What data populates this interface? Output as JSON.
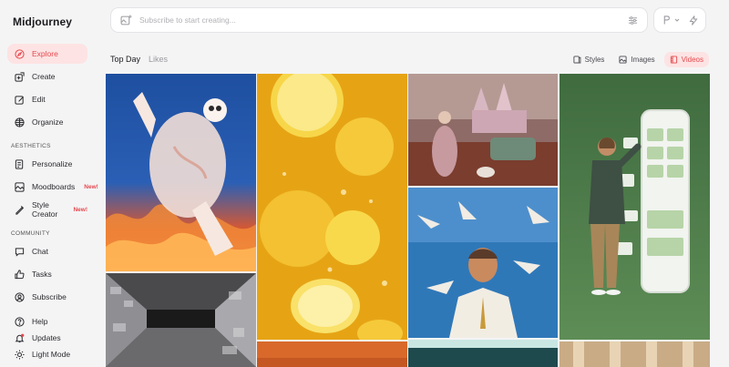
{
  "app": {
    "brand": "Midjourney"
  },
  "sidebar": {
    "main_items": [
      {
        "label": "Explore",
        "icon": "compass-icon",
        "active": true
      },
      {
        "label": "Create",
        "icon": "create-icon"
      },
      {
        "label": "Edit",
        "icon": "edit-icon"
      },
      {
        "label": "Organize",
        "icon": "grid-icon"
      }
    ],
    "aesthetics_label": "AESTHETICS",
    "aesthetics_items": [
      {
        "label": "Personalize",
        "icon": "personalize-icon"
      },
      {
        "label": "Moodboards",
        "icon": "moodboard-icon",
        "badge": "New!"
      },
      {
        "label": "Style Creator",
        "icon": "style-creator-icon",
        "badge": "New!"
      }
    ],
    "community_label": "COMMUNITY",
    "community_items": [
      {
        "label": "Chat",
        "icon": "chat-icon"
      },
      {
        "label": "Tasks",
        "icon": "thumbs-up-icon"
      },
      {
        "label": "Subscribe",
        "icon": "user-circle-icon"
      }
    ],
    "bottom_items": [
      {
        "label": "Help",
        "icon": "help-icon"
      },
      {
        "label": "Updates",
        "icon": "bell-icon"
      },
      {
        "label": "Light Mode",
        "icon": "sun-icon"
      }
    ]
  },
  "search": {
    "placeholder": "Subscribe to start creating..."
  },
  "feed_tabs": [
    {
      "label": "Top Day",
      "active": true
    },
    {
      "label": "Likes",
      "active": false
    }
  ],
  "view_tabs": [
    {
      "label": "Styles",
      "active": false
    },
    {
      "label": "Images",
      "active": false
    },
    {
      "label": "Videos",
      "active": true
    }
  ],
  "colors": {
    "accent": "#e5484d",
    "accent_bg": "#fde3e3",
    "background": "#f4f4f5"
  }
}
